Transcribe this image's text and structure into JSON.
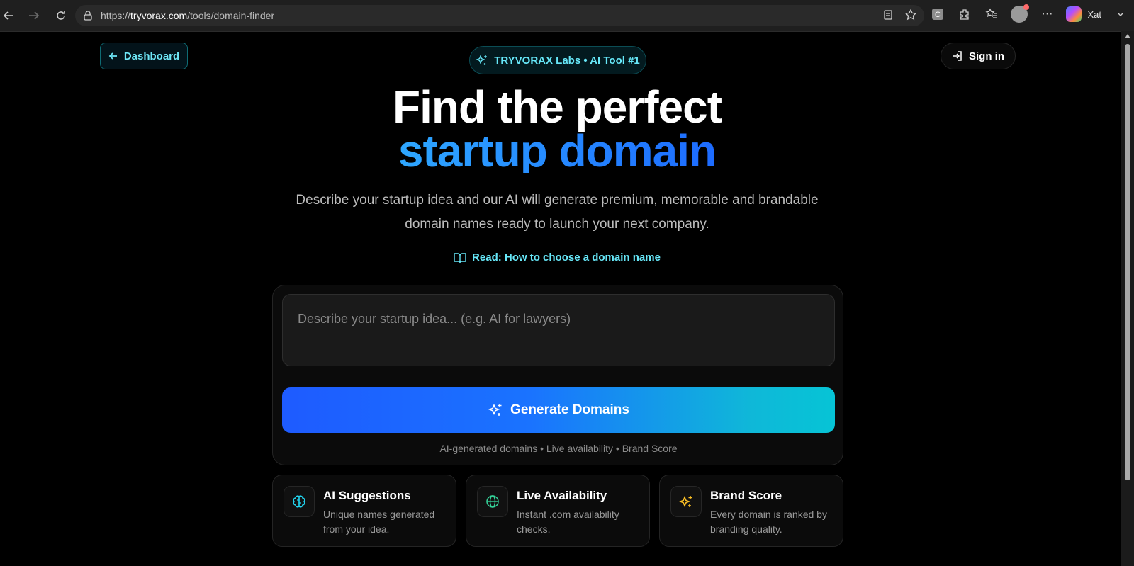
{
  "browser": {
    "url_host": "tryvorax.com",
    "url_path": "/tools/domain-finder",
    "url_scheme": "https://",
    "profile_label": "Xat"
  },
  "nav": {
    "dashboard_label": "Dashboard",
    "badge_label": "TRYVORAX Labs • AI Tool #1",
    "signin_label": "Sign in"
  },
  "hero": {
    "title_line1": "Find the perfect",
    "title_line2": "startup domain",
    "subtitle": "Describe your startup idea and our AI will generate premium, memorable and brandable domain names ready to launch your next company.",
    "guide_link": "Read: How to choose a domain name"
  },
  "form": {
    "placeholder": "Describe your startup idea... (e.g. AI for lawyers)",
    "button_label": "Generate Domains",
    "footnote": "AI-generated domains • Live availability • Brand Score"
  },
  "features": [
    {
      "title": "AI Suggestions",
      "description": "Unique names generated from your idea.",
      "icon": "brain-icon",
      "color": "#22d3ee"
    },
    {
      "title": "Live Availability",
      "description": "Instant .com availability checks.",
      "icon": "globe-icon",
      "color": "#34d399"
    },
    {
      "title": "Brand Score",
      "description": "Every domain is ranked by branding quality.",
      "icon": "sparkles-icon",
      "color": "#fbbf24"
    }
  ],
  "colors": {
    "accent_cyan": "#67e8f9",
    "accent_blue": "#1d6bff",
    "background": "#000000"
  }
}
